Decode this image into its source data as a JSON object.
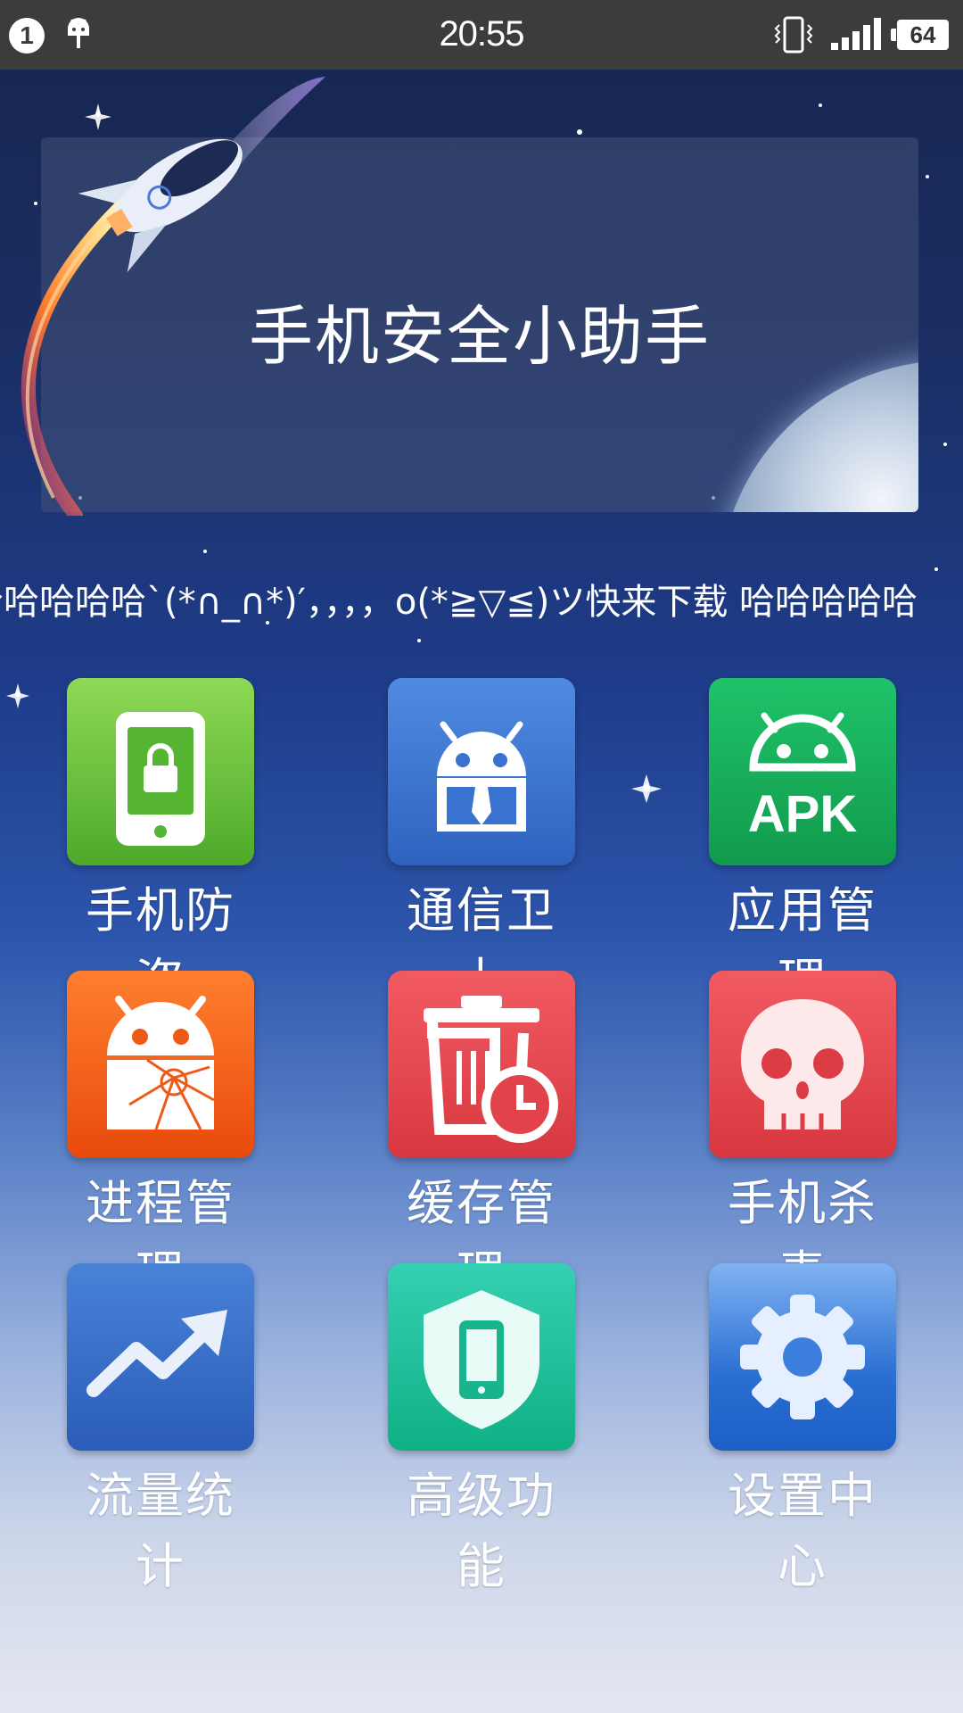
{
  "status_bar": {
    "notification_count": "1",
    "time": "20:55",
    "battery": "64",
    "icons": [
      "notification-badge-icon",
      "android-debug-icon",
      "vibrate-icon",
      "signal-icon",
      "battery-icon"
    ]
  },
  "banner": {
    "title": "手机安全小助手"
  },
  "marquee": {
    "text": "哈哈哈哈哈`(*∩_∩*)′，，，，o(*≧▽≦)ツ快来下载  哈哈哈哈哈"
  },
  "grid": {
    "items": [
      {
        "label": "手机防盗",
        "icon": "phone-lock-icon",
        "color": "#6cc644"
      },
      {
        "label": "通信卫士",
        "icon": "android-guard-icon",
        "color": "#3e7ad1"
      },
      {
        "label": "应用管理",
        "icon": "apk-android-icon",
        "color": "#1aa95a"
      },
      {
        "label": "进程管理",
        "icon": "android-broken-icon",
        "color": "#f05a14"
      },
      {
        "label": "缓存管理",
        "icon": "trash-clock-icon",
        "color": "#e5454d"
      },
      {
        "label": "手机杀毒",
        "icon": "skull-icon",
        "color": "#e5454d"
      },
      {
        "label": "流量统计",
        "icon": "trend-up-icon",
        "color": "#3a6ec8"
      },
      {
        "label": "高级功能",
        "icon": "shield-phone-icon",
        "color": "#19b894"
      },
      {
        "label": "设置中心",
        "icon": "gear-icon",
        "color": "#2a6fd2"
      }
    ]
  }
}
